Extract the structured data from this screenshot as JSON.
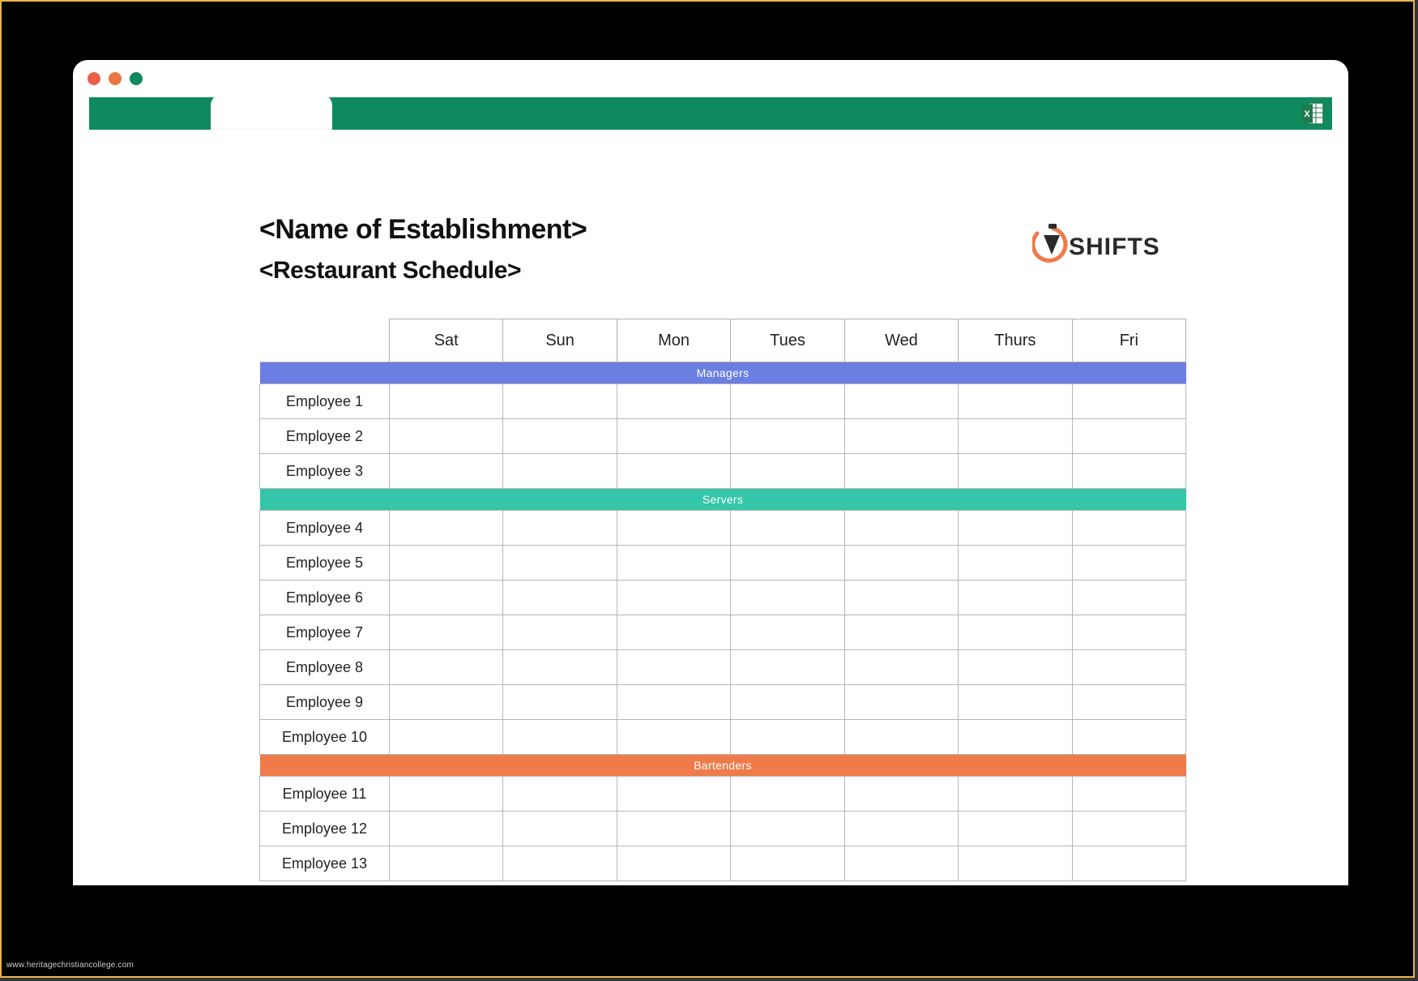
{
  "watermark": "www.heritagechristiancollege.com",
  "header": {
    "title": "<Name of Establishment>",
    "subtitle": "<Restaurant Schedule>",
    "brand": "7SHIFTS"
  },
  "ribbon": {
    "app_color": "#0f8a5f",
    "excel_icon": "excel"
  },
  "traffic": {
    "red": "#e95f4a",
    "yellow": "#ec773e",
    "green": "#0f8a5f"
  },
  "schedule": {
    "days": [
      "Sat",
      "Sun",
      "Mon",
      "Tues",
      "Wed",
      "Thurs",
      "Fri"
    ],
    "groups": [
      {
        "name": "Managers",
        "color": "#6b7fe3",
        "employees": [
          "Employee 1",
          "Employee 2",
          "Employee 3"
        ]
      },
      {
        "name": "Servers",
        "color": "#35c6a9",
        "employees": [
          "Employee 4",
          "Employee 5",
          "Employee 6",
          "Employee 7",
          "Employee 8",
          "Employee 9",
          "Employee 10"
        ]
      },
      {
        "name": "Bartenders",
        "color": "#ef7b4a",
        "employees": [
          "Employee 11",
          "Employee 12",
          "Employee 13"
        ]
      }
    ]
  }
}
